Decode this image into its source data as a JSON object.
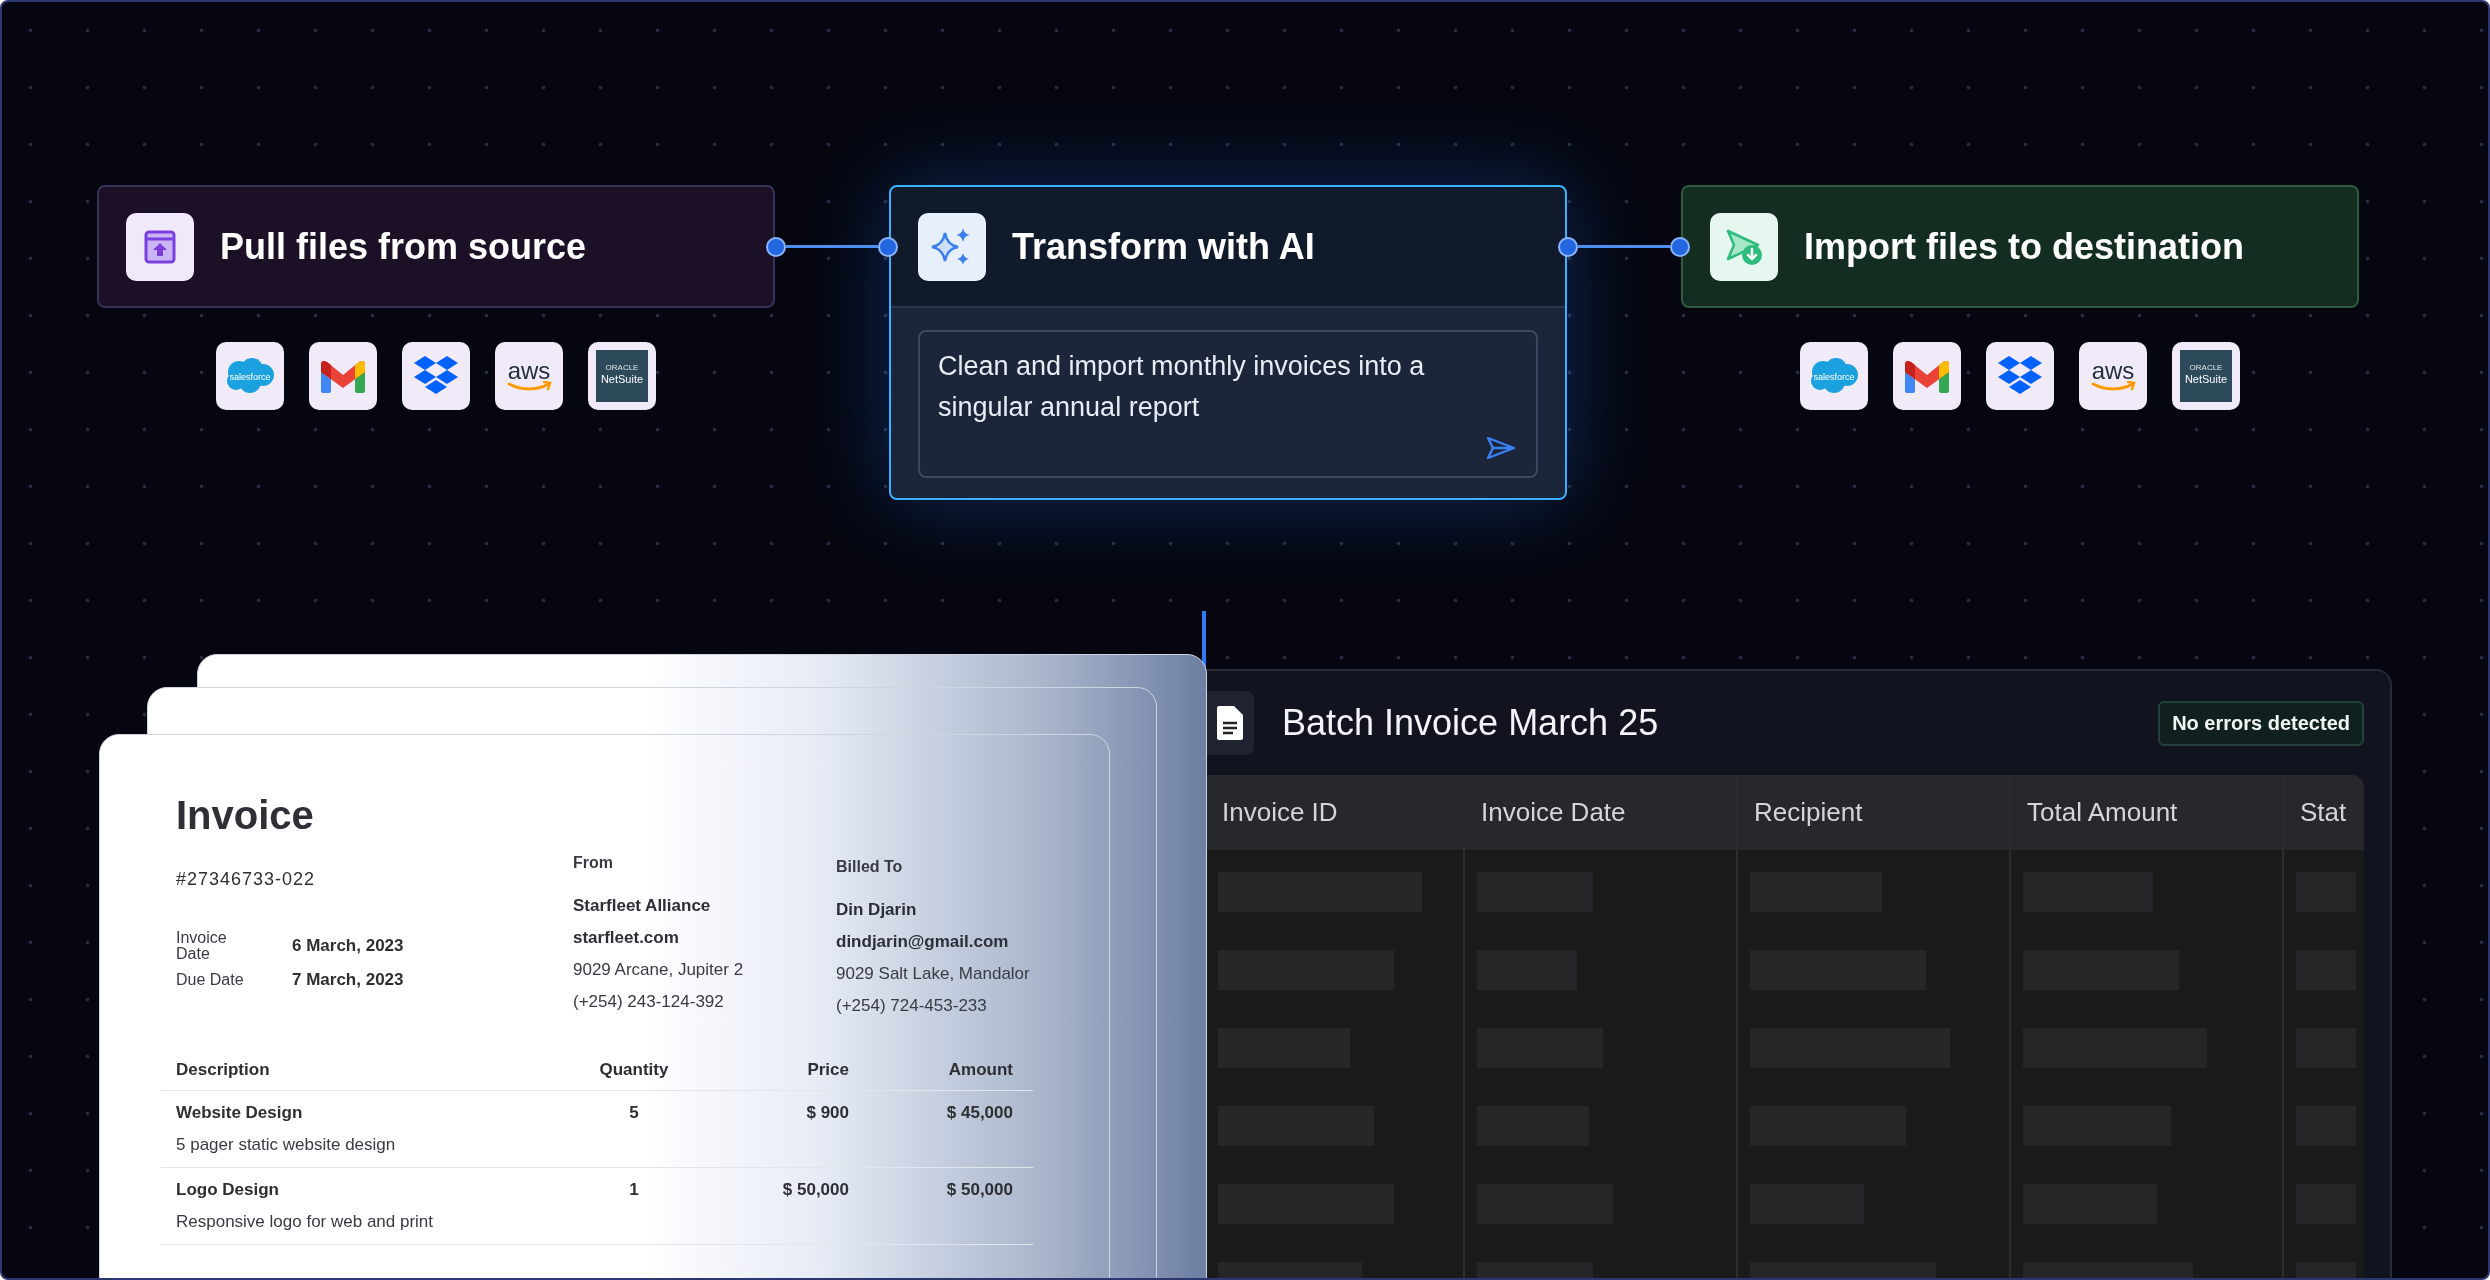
{
  "pipeline": {
    "steps": [
      {
        "kind": "source",
        "title": "Pull files from source",
        "integrations": [
          {
            "kind": "salesforce",
            "label": "salesforce"
          },
          {
            "kind": "gmail"
          },
          {
            "kind": "dropbox"
          },
          {
            "kind": "aws",
            "label": "aws"
          },
          {
            "kind": "netsuite",
            "label": "NetSuite",
            "sublabel": "ORACLE"
          }
        ]
      },
      {
        "kind": "transform",
        "title": "Transform with AI",
        "prompt": "Clean and import monthly invoices into a singular annual report"
      },
      {
        "kind": "destination",
        "title": "Import files to destination",
        "integrations": [
          {
            "kind": "salesforce",
            "label": "salesforce"
          },
          {
            "kind": "gmail"
          },
          {
            "kind": "dropbox"
          },
          {
            "kind": "aws",
            "label": "aws"
          },
          {
            "kind": "netsuite",
            "label": "NetSuite",
            "sublabel": "ORACLE"
          }
        ]
      }
    ]
  },
  "invoice": {
    "title": "Invoice",
    "number": "#27346733-022",
    "dates": [
      {
        "label": "Invoice Date",
        "value": "6 March, 2023"
      },
      {
        "label": "Due Date",
        "value": "7 March, 2023"
      }
    ],
    "parties": [
      {
        "heading": "From",
        "lines": [
          {
            "text": "Starfleet Alliance",
            "bold": true
          },
          {
            "text": "starfleet.com",
            "bold": true
          },
          {
            "text": "9029 Arcane, Jupiter 2",
            "bold": false
          },
          {
            "text": "(+254) 243-124-392",
            "bold": false
          }
        ]
      },
      {
        "heading": "Billed To",
        "lines": [
          {
            "text": "Din Djarin",
            "bold": true
          },
          {
            "text": "dindjarin@gmail.com",
            "bold": true
          },
          {
            "text": "9029 Salt Lake, Mandalor",
            "bold": false
          },
          {
            "text": "(+254) 724-453-233",
            "bold": false
          }
        ]
      }
    ],
    "columns": [
      "Description",
      "Quantity",
      "Price",
      "Amount"
    ],
    "items": [
      {
        "name": "Website Design",
        "detail": "5 pager static website design",
        "quantity": "5",
        "price": "$ 900",
        "amount": "$ 45,000"
      },
      {
        "name": "Logo Design",
        "detail": "Responsive logo for web and print",
        "quantity": "1",
        "price": "$ 50,000",
        "amount": "$ 50,000"
      }
    ]
  },
  "batch": {
    "title": "Batch Invoice March 25",
    "status": "No errors detected",
    "columns": [
      "Invoice ID",
      "Invoice Date",
      "Recipient",
      "Total Amount",
      "Stat"
    ]
  }
}
